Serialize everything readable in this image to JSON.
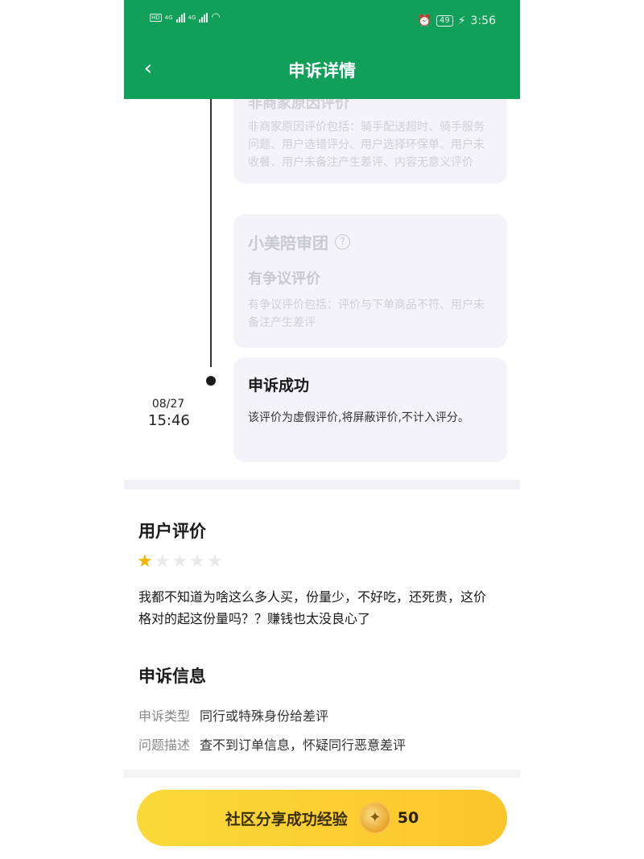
{
  "status_bar": {
    "network_left": "HD",
    "network_left2": "HD",
    "signal_label_1": "4G",
    "signal_label_2": "4G",
    "battery": "49",
    "time": "3:56"
  },
  "header": {
    "title": "申诉详情"
  },
  "timeline": {
    "cards": [
      {
        "subtitle": "非商家原因评价",
        "text": "非商家原因评价包括：骑手配送超时、骑手服务问题、用户选错评分、用户选择环保单、用户未收餐、用户未备注产生差评、内容无意义评价"
      },
      {
        "title": "小美陪审团",
        "subtitle": "有争议评价",
        "text": "有争议评价包括：评价与下单商品不符、用户未备注产生差评"
      },
      {
        "title": "申诉成功",
        "text": "该评价为虚假评价,将屏蔽评价,不计入评分。",
        "date": "08/27",
        "time": "15:46"
      }
    ]
  },
  "user_review": {
    "title": "用户评价",
    "rating": 1,
    "max_rating": 5,
    "text": "我都不知道为啥这么多人买，份量少，不好吃，还死贵，这价格对的起这份量吗？？赚钱也太没良心了"
  },
  "appeal_info": {
    "title": "申诉信息",
    "type_label": "申诉类型",
    "type_value": "同行或特殊身份给差评",
    "desc_label": "问题描述",
    "desc_value": "查不到订单信息，怀疑同行恶意差评"
  },
  "banner": {
    "label": "社区分享成功经验",
    "coins": "50"
  },
  "colors": {
    "header_green": "#11a05a",
    "banner_yellow": "#fbd93a",
    "star_on": "#f5b400"
  }
}
